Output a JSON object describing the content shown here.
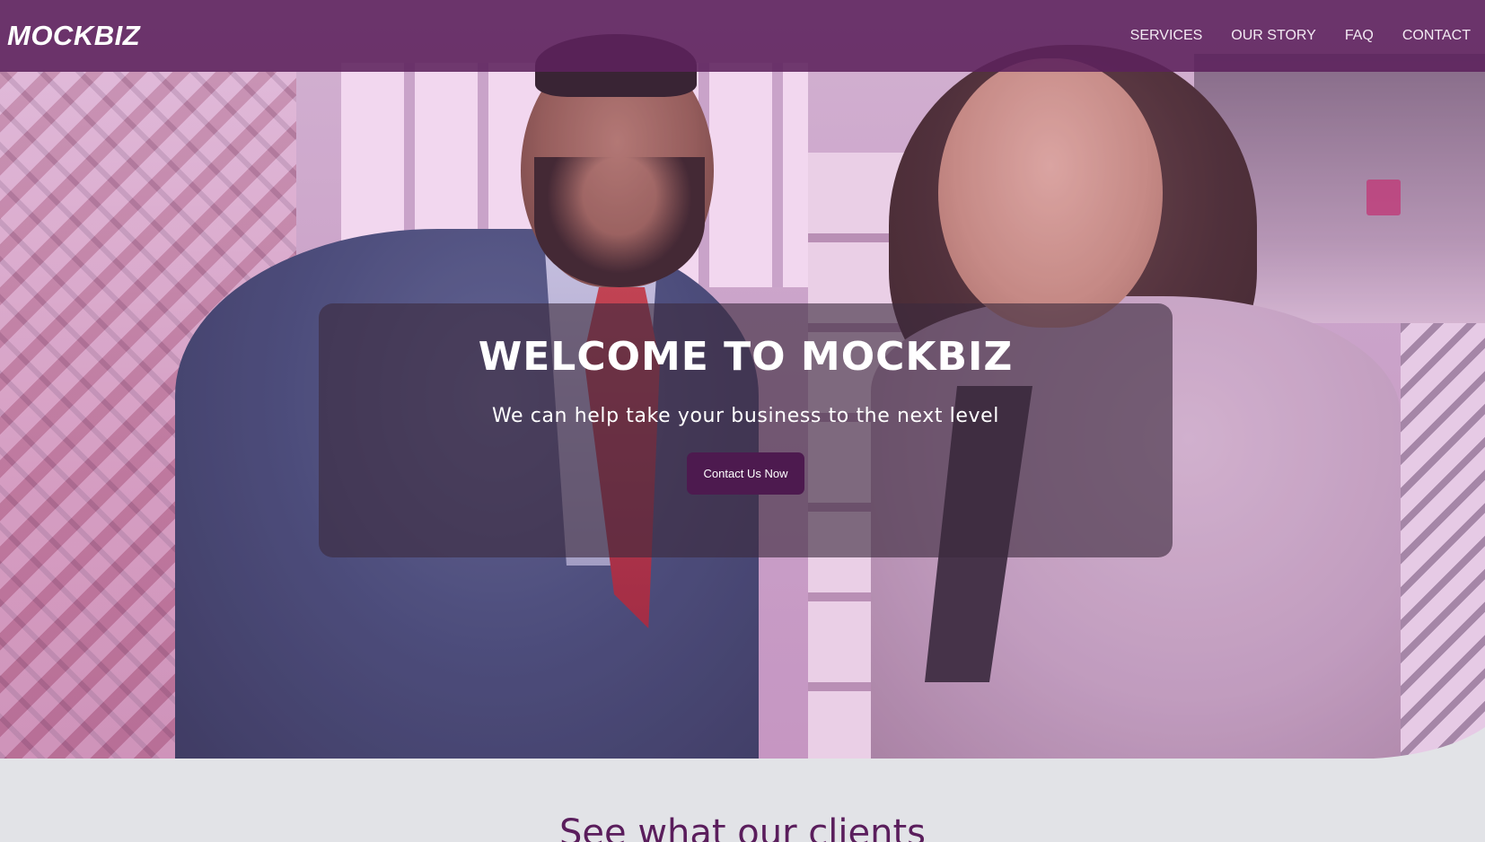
{
  "brand": {
    "name": "MOCKBIZ"
  },
  "nav": {
    "items": [
      {
        "label": "SERVICES"
      },
      {
        "label": "OUR STORY"
      },
      {
        "label": "FAQ"
      },
      {
        "label": "CONTACT"
      }
    ]
  },
  "hero": {
    "title": "WELCOME TO MOCKBIZ",
    "subtitle": "We can help take your business to the next level",
    "cta_label": "Contact Us Now"
  },
  "clients": {
    "heading": "See what our clients"
  },
  "colors": {
    "nav_bg": "#5c225c",
    "accent": "#4d1a4f",
    "heading": "#5a1d5c",
    "section_bg": "#e2e3e7"
  }
}
